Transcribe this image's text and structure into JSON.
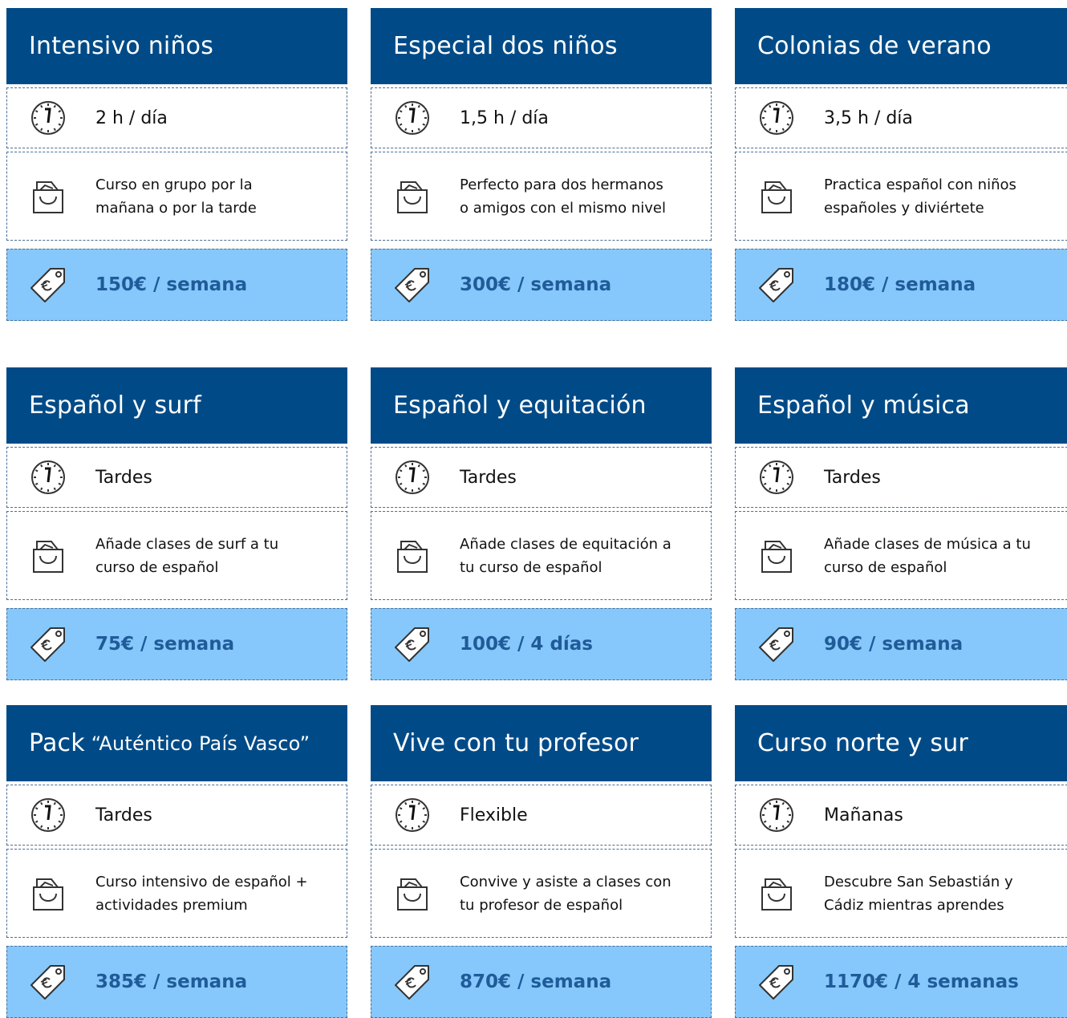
{
  "cards": [
    {
      "title": "Intensivo niños",
      "subtitle": "",
      "time": "2 h / día",
      "description": "Curso en grupo por la mañana o por la tarde",
      "price": "150€ / semana"
    },
    {
      "title": "Especial dos niños",
      "subtitle": "",
      "time": "1,5 h / día",
      "description": "Perfecto para dos hermanos o amigos con el mismo nivel",
      "price": "300€ / semana"
    },
    {
      "title": "Colonias de verano",
      "subtitle": "",
      "time": "3,5 h / día",
      "description": "Practica español con niños españoles y diviértete",
      "price": "180€ / semana"
    },
    {
      "title": "Español y surf",
      "subtitle": "",
      "time": "Tardes",
      "description": "Añade clases de surf a tu curso de español",
      "price": "75€ / semana"
    },
    {
      "title": "Español y equitación",
      "subtitle": "",
      "time": "Tardes",
      "description": "Añade clases de equitación a tu curso de español",
      "price": "100€ / 4 días"
    },
    {
      "title": "Español y música",
      "subtitle": "",
      "time": "Tardes",
      "description": "Añade clases de música a tu curso de español",
      "price": "90€ / semana"
    },
    {
      "title": "Pack",
      "subtitle": "“Auténtico País Vasco”",
      "time": "Tardes",
      "description": "Curso intensivo  de español + actividades premium",
      "price": "385€ / semana"
    },
    {
      "title": "Vive con tu profesor",
      "subtitle": "",
      "time": "Flexible",
      "description": "Convive y asiste a clases con tu profesor de español",
      "price": "870€ / semana"
    },
    {
      "title": "Curso norte y sur",
      "subtitle": "",
      "time": "Mañanas",
      "description": "Descubre San Sebastián y Cádiz mientras aprendes",
      "price": "1170€ / 4 semanas"
    }
  ],
  "icons": {
    "time": "clock-icon",
    "description": "shopping-bag-icon",
    "price": "euro-price-tag-icon"
  },
  "colors": {
    "header": "#004b87",
    "price_bg": "#86c8fb",
    "price_text": "#1f5b99",
    "border": "#4a6e96"
  }
}
